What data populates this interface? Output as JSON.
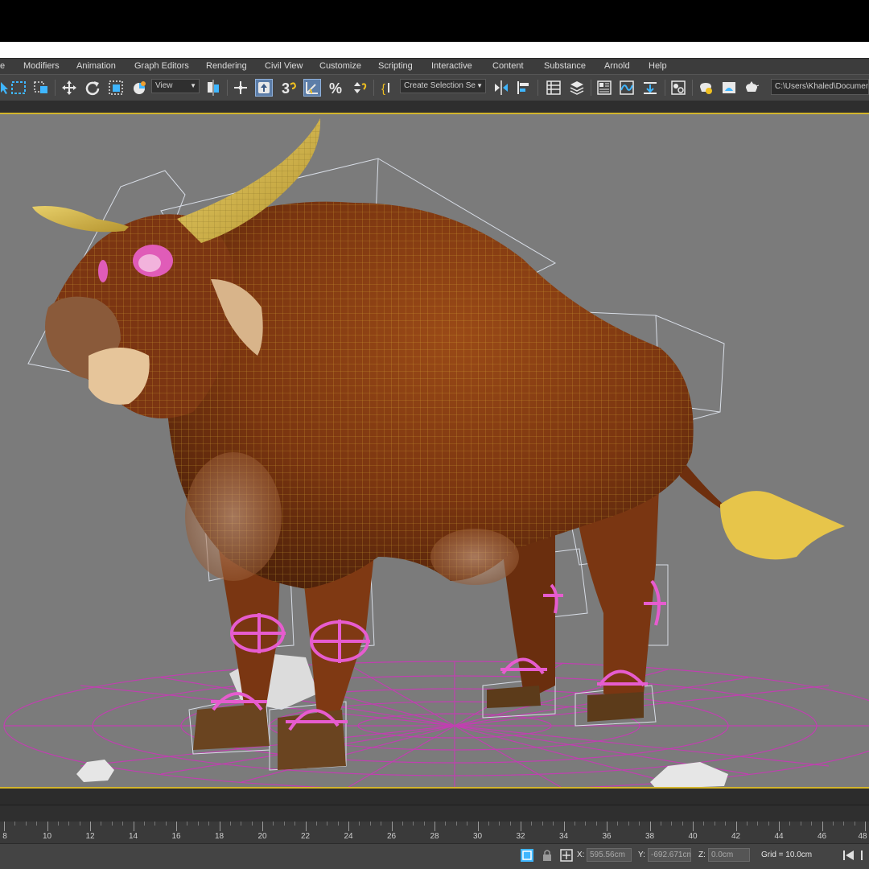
{
  "menu": {
    "items": [
      "e",
      "Modifiers",
      "Animation",
      "Graph Editors",
      "Rendering",
      "Civil View",
      "Customize",
      "Scripting",
      "Interactive",
      "Content",
      "Substance",
      "Arnold",
      "Help"
    ]
  },
  "toolbar": {
    "ref_coord_label": "View",
    "selection_set_label": "Create Selection Se",
    "snap_label": "3",
    "percent_label": "%",
    "path": "C:\\Users\\Khaled\\Documents"
  },
  "timeline": {
    "ticks": [
      "8",
      "10",
      "12",
      "14",
      "16",
      "18",
      "20",
      "22",
      "24",
      "26",
      "28",
      "30",
      "32",
      "34",
      "36",
      "38",
      "40",
      "42",
      "44",
      "46",
      "48"
    ]
  },
  "status": {
    "x_label": "X:",
    "x_value": "595.56cm",
    "y_label": "Y:",
    "y_value": "-692.671cm",
    "z_label": "Z:",
    "z_value": "0.0cm",
    "grid": "Grid = 10.0cm"
  },
  "colors": {
    "accent": "#d3b52b",
    "viewport_bg": "#7b7b7b",
    "helper_pink": "#e65ccf",
    "bull_body": "#8a4214"
  }
}
